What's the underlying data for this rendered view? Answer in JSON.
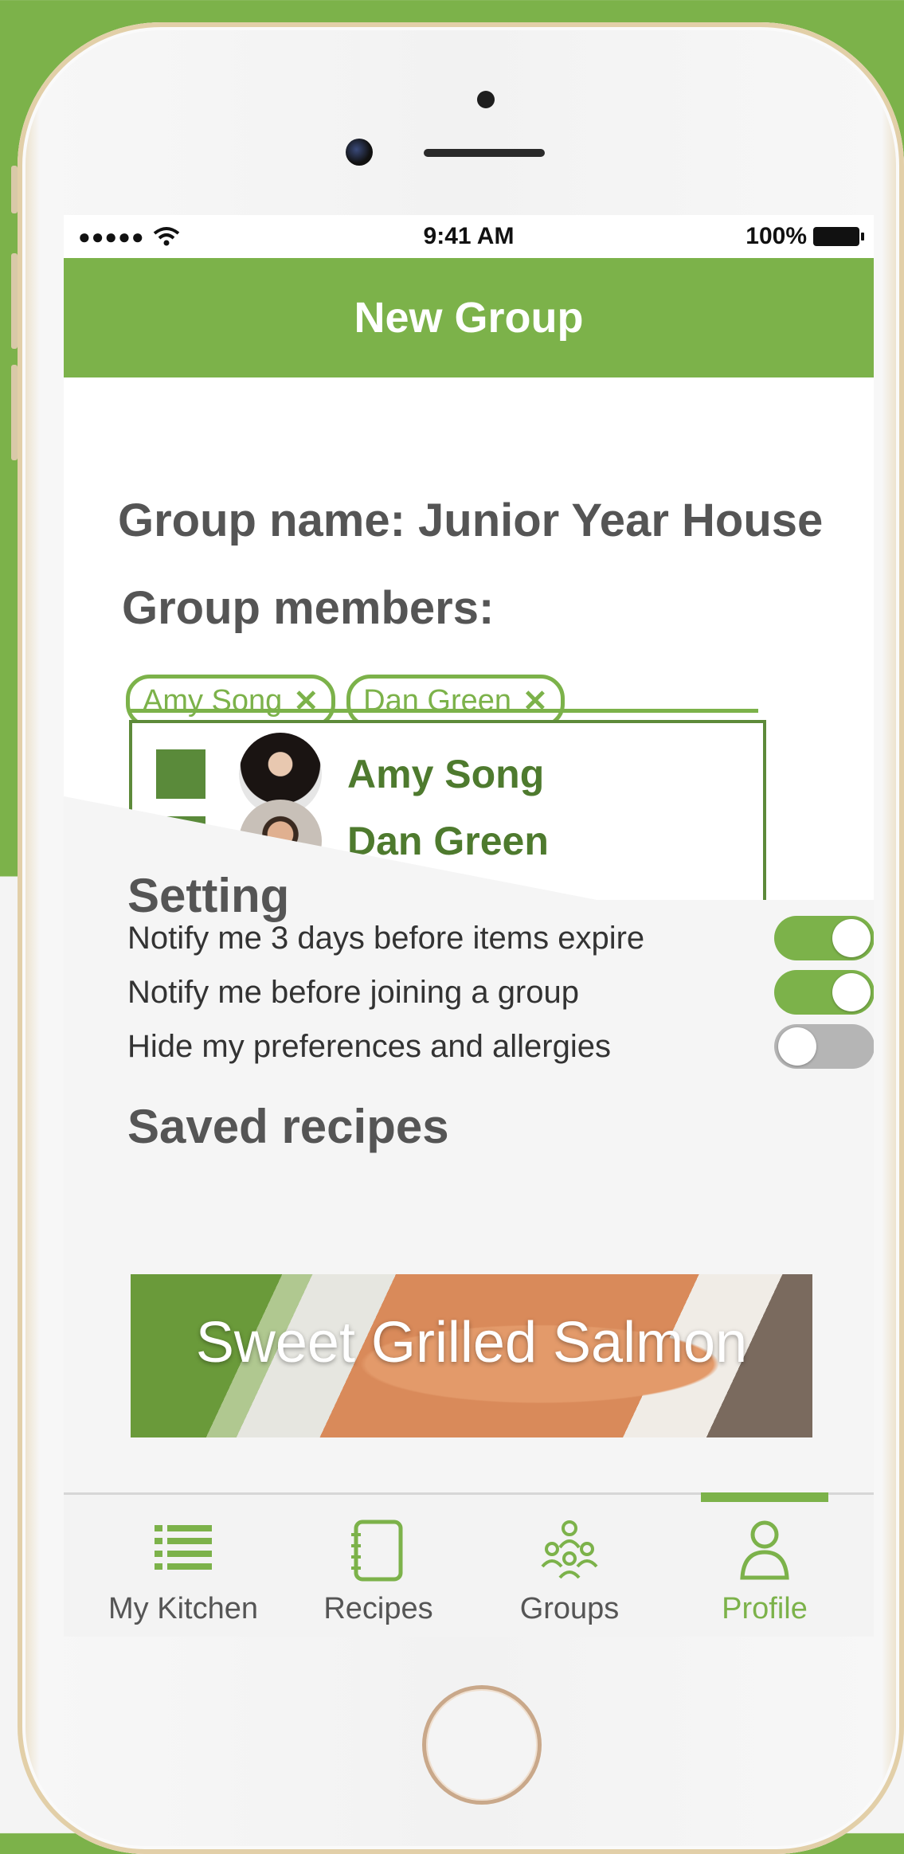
{
  "status_bar": {
    "time": "9:41 AM",
    "battery": "100%",
    "signal_dots": "●●●●●"
  },
  "header": {
    "title": "New Group"
  },
  "group": {
    "name_label": "Group name: Junior Year House",
    "members_label": "Group members:",
    "chips": [
      {
        "label": "Amy Song",
        "remove": "✕"
      },
      {
        "label": "Dan Green",
        "remove": "✕"
      }
    ],
    "member_list": [
      {
        "name": "Amy Song"
      },
      {
        "name": "Dan Green"
      }
    ]
  },
  "settings": {
    "title": "Setting",
    "items": [
      {
        "label": "Notify me 3 days before items expire",
        "on": true
      },
      {
        "label": "Notify me before joining a group",
        "on": true
      },
      {
        "label": "Hide my preferences and allergies",
        "on": false
      }
    ]
  },
  "saved_recipes": {
    "title": "Saved recipes",
    "card": {
      "title": "Sweet Grilled Salmon"
    }
  },
  "tabbar": {
    "items": [
      {
        "label": "My Kitchen",
        "icon": "list-icon"
      },
      {
        "label": "Recipes",
        "icon": "notebook-icon"
      },
      {
        "label": "Groups",
        "icon": "group-icon"
      },
      {
        "label": "Profile",
        "icon": "profile-icon"
      }
    ],
    "active": "Profile"
  },
  "colors": {
    "brand_green": "#7cb24a",
    "dark_green": "#5a8a3a",
    "text_gray": "#555555"
  }
}
